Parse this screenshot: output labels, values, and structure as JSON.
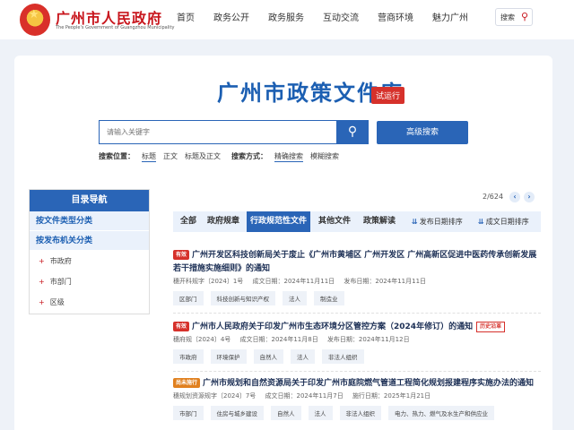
{
  "header": {
    "site_name": "广州市人民政府",
    "site_name_en": "The People's Government of Guangzhou Municipality",
    "nav": [
      "首页",
      "政务公开",
      "政务服务",
      "互动交流",
      "营商环境",
      "魅力广州"
    ],
    "search_label": "搜索"
  },
  "library": {
    "title": "广州市政策文件库",
    "badge": "试运行",
    "search_placeholder": "请输入关键字",
    "advanced_search": "高级搜索",
    "search_position_label": "搜索位置：",
    "search_positions": [
      "标题",
      "正文",
      "标题及正文"
    ],
    "search_mode_label": "搜索方式：",
    "search_modes": [
      "精确搜索",
      "模糊搜索"
    ]
  },
  "sidebar": {
    "title": "目录导航",
    "categories": [
      "按文件类型分类",
      "按发布机关分类"
    ],
    "items": [
      "市政府",
      "市部门",
      "区级"
    ]
  },
  "content": {
    "pager": "2/624",
    "tabs": [
      "全部",
      "政府规章",
      "行政规范性文件",
      "其他文件",
      "政策解读"
    ],
    "sort_publish": "发布日期排序",
    "sort_effective": "成文日期排序",
    "records": [
      {
        "status": "有效",
        "title": "广州开发区科技创新局关于废止《广州市黄埔区 广州开发区 广州高新区促进中医药传承创新发展若干措施实施细则》的通知",
        "doc_no": "穗开科规字〔2024〕1号",
        "written_date": "成文日期：2024年11月11日",
        "publish_date": "发布日期：2024年11月11日",
        "tags": [
          "区部门",
          "科技创新与知识产权",
          "法人",
          "制造业"
        ]
      },
      {
        "status": "有效",
        "title": "广州市人民政府关于印发广州市生态环境分区管控方案（2024年修订）的通知",
        "history": "历史沿革",
        "doc_no": "穗府规〔2024〕4号",
        "written_date": "成文日期：2024年11月8日",
        "publish_date": "发布日期：2024年11月12日",
        "tags": [
          "市政府",
          "环境保护",
          "自然人",
          "法人",
          "非法人组织"
        ]
      },
      {
        "status": "尚未施行",
        "title": "广州市规划和自然资源局关于印发广州市庭院燃气管道工程简化规划报建程序实施办法的通知",
        "doc_no": "穗规划资源规字〔2024〕7号",
        "written_date": "成文日期：2024年11月7日",
        "publish_date": "施行日期：2025年1月21日",
        "tags": [
          "市部门",
          "住房与城乡建设",
          "自然人",
          "法人",
          "非法人组织",
          "电力、热力、燃气及水生产和供应业"
        ]
      }
    ]
  },
  "colors": {
    "brand_red": "#c8161d",
    "primary_blue": "#2a65b7"
  }
}
